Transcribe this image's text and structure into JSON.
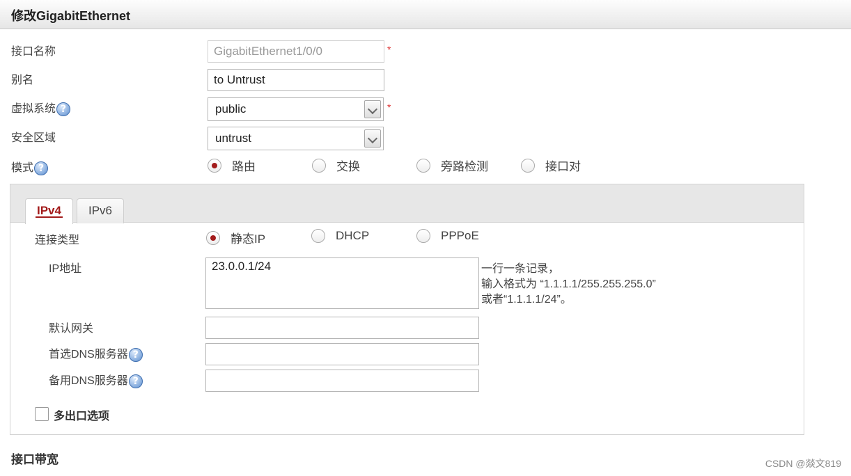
{
  "window": {
    "title": "修改GigabitEthernet"
  },
  "form": {
    "interface_name_label": "接口名称",
    "interface_name_value": "GigabitEthernet1/0/0",
    "alias_label": "别名",
    "alias_value": "to Untrust",
    "vsys_label": "虚拟系统",
    "vsys_value": "public",
    "zone_label": "安全区域",
    "zone_value": "untrust",
    "mode_label": "模式",
    "mode_options": [
      "路由",
      "交换",
      "旁路检测",
      "接口对"
    ],
    "mode_selected": "路由",
    "required_mark": "*",
    "help_glyph": "?"
  },
  "tabs": [
    {
      "label": "IPv4",
      "active": true
    },
    {
      "label": "IPv6",
      "active": false
    }
  ],
  "ipv4": {
    "conn_type_label": "连接类型",
    "conn_options": [
      "静态IP",
      "DHCP",
      "PPPoE"
    ],
    "conn_selected": "静态IP",
    "ip_label": "IP地址",
    "ip_value": "23.0.0.1/24",
    "ip_hint": [
      "一行一条记录，",
      "输入格式为 “1.1.1.1/255.255.255.0”",
      "或者“1.1.1.1/24”。"
    ],
    "gateway_label": "默认网关",
    "gateway_value": "",
    "dns1_label": "首选DNS服务器",
    "dns1_value": "",
    "dns2_label": "备用DNS服务器",
    "dns2_value": "",
    "multi_exit_label": "多出口选项",
    "multi_exit_checked": false
  },
  "bandwidth": {
    "label": "接口带宽"
  },
  "watermark": "CSDN @燚文819",
  "colors": {
    "accent": "#a31b1b",
    "required": "#dd3333",
    "help": "#5d8fd0"
  }
}
